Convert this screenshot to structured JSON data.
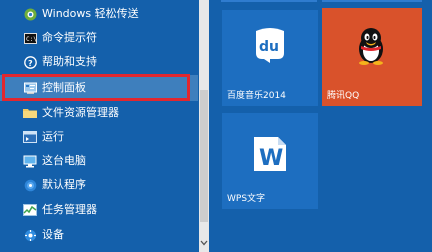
{
  "menu": {
    "items": [
      {
        "label": "Windows 轻松传送",
        "icon": "transfer-icon"
      },
      {
        "label": "命令提示符",
        "icon": "cmd-icon"
      },
      {
        "label": "帮助和支持",
        "icon": "help-icon"
      },
      {
        "label": "控制面板",
        "icon": "control-panel-icon"
      },
      {
        "label": "文件资源管理器",
        "icon": "folder-icon"
      },
      {
        "label": "运行",
        "icon": "run-icon"
      },
      {
        "label": "这台电脑",
        "icon": "computer-icon"
      },
      {
        "label": "默认程序",
        "icon": "default-programs-icon"
      },
      {
        "label": "任务管理器",
        "icon": "task-manager-icon"
      },
      {
        "label": "设备",
        "icon": "devices-icon"
      }
    ],
    "selected_index": 3
  },
  "tiles": [
    {
      "label": "百度音乐2014",
      "icon": "baidu-music-icon",
      "color": "#1d6ec0"
    },
    {
      "label": "腾讯QQ",
      "icon": "qq-penguin-icon",
      "color": "#d9522b"
    },
    {
      "label": "WPS文字",
      "icon": "wps-writer-icon",
      "color": "#1d6ec0"
    }
  ],
  "colors": {
    "menu_bg": "#1460ab",
    "selected_bg": "#3e7fbd",
    "highlight_border": "#e2272f"
  }
}
